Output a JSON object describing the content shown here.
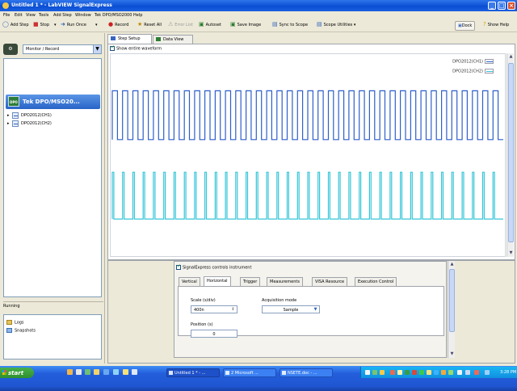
{
  "window": {
    "title": "Untitled 1 * - LabVIEW SignalExpress",
    "controls": [
      "_",
      "□",
      "×"
    ]
  },
  "menu": [
    "File",
    "Edit",
    "View",
    "Tools",
    "Add Step",
    "Window",
    "Tek DPO/MSO2000",
    "Help"
  ],
  "toolbar": {
    "add_step": "Add Step",
    "stop": "Stop",
    "run_once": "Run Once",
    "record": "Record",
    "reset_all": "Reset All",
    "error_list": "Error List",
    "autoset": "Autoset",
    "save_image": "Save Image",
    "sync_to_scope": "Sync to Scope",
    "scope_utilities": "Scope Utilities",
    "dock": "Dock",
    "show_help": "Show Help"
  },
  "left_panel": {
    "mode": "Monitor / Record",
    "device": "Tek DPO/MSO20...",
    "device_chip": "DPO",
    "channels": [
      "DPO2012(CH1)",
      "DPO2012(CH2)"
    ],
    "running_label": "Running",
    "logs": [
      "Logs",
      "Snapshots"
    ]
  },
  "main_tabs": {
    "step_setup": "Step Setup",
    "data_view": "Data View"
  },
  "graph": {
    "show_entire_waveform": "Show entire waveform",
    "legend": [
      {
        "name": "DPO2012(CH1)",
        "color": "#2d5fc9"
      },
      {
        "name": "DPO2012(CH2)",
        "color": "#36c6d8"
      }
    ]
  },
  "chart_data": {
    "type": "line",
    "series": [
      {
        "name": "DPO2012(CH1)",
        "color": "#2d5fc9",
        "style": "square wave",
        "cycles": 38,
        "high_level": 0.82,
        "low_level": 0.58
      },
      {
        "name": "DPO2012(CH2)",
        "color": "#36c6d8",
        "style": "pulse train",
        "cycles": 38,
        "high_level": 0.42,
        "low_level": 0.19
      }
    ],
    "grid": false
  },
  "config": {
    "controls_instrument": "SignalExpress controls instrument",
    "tabs": [
      "Vertical",
      "Horizontal",
      "Trigger",
      "Measurements",
      "VISA Resource",
      "Execution Control"
    ],
    "active_tab": "Horizontal",
    "scale_label": "Scale (s/div)",
    "scale_value": "400n",
    "acquisition_label": "Acquisition mode",
    "acquisition_value": "Sample",
    "position_label": "Position (s)",
    "position_value": "0"
  },
  "taskbar": {
    "start": "start",
    "tasks": [
      "Untitled 1 * - ...",
      "2 Microsoft ...",
      "NSETE.doc - ..."
    ],
    "clock": "3:28 PM"
  }
}
